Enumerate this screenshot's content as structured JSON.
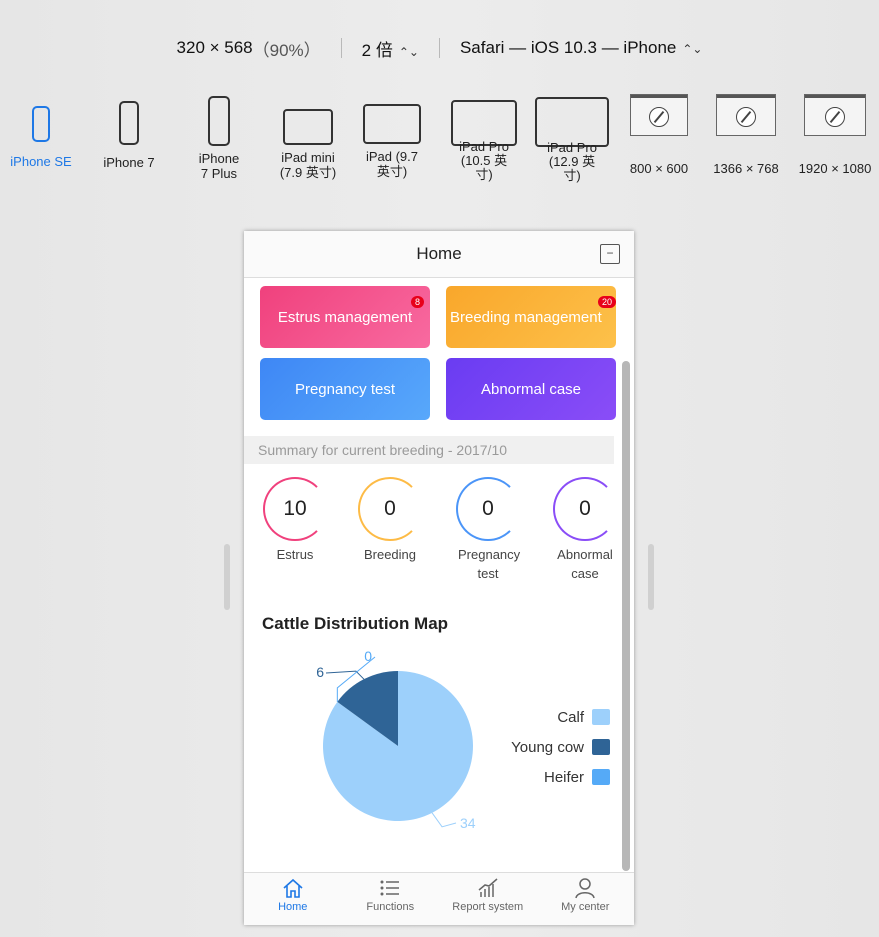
{
  "toolbar": {
    "resolution": "320 × 568",
    "zoom": "（90%）",
    "scale": "2 倍",
    "browser": "Safari — iOS 10.3 — iPhone"
  },
  "devices": [
    {
      "label": "iPhone SE",
      "icon": "phone-icon",
      "selected": true
    },
    {
      "label": "iPhone 7",
      "icon": "phone-icon",
      "selected": false
    },
    {
      "label": "iPhone 7 Plus",
      "icon": "phone-icon",
      "selected": false
    },
    {
      "label": "iPad mini (7.9 英寸)",
      "icon": "tablet-icon",
      "selected": false
    },
    {
      "label": "iPad (9.7 英寸)",
      "icon": "tablet-icon",
      "selected": false
    },
    {
      "label": "iPad Pro (10.5 英寸)",
      "icon": "tablet-icon",
      "selected": false
    },
    {
      "label": "iPad Pro (12.9 英寸)",
      "icon": "tablet-icon",
      "selected": false
    },
    {
      "label": "800 × 600",
      "icon": "safari-window-icon",
      "selected": false
    },
    {
      "label": "1366 × 768",
      "icon": "safari-window-icon",
      "selected": false
    },
    {
      "label": "1920 × 1080",
      "icon": "safari-window-icon",
      "selected": false
    }
  ],
  "app": {
    "title": "Home",
    "cards": [
      {
        "label": "Estrus management",
        "badge": "8",
        "color_from": "#f0417d",
        "color_to": "#f86aa0"
      },
      {
        "label": "Breeding management",
        "badge": "20",
        "color_from": "#f9a72b",
        "color_to": "#fdc14a"
      },
      {
        "label": "Pregnancy test",
        "badge": "",
        "color_from": "#3e87f5",
        "color_to": "#58a8fb"
      },
      {
        "label": "Abnormal case",
        "badge": "",
        "color_from": "#6a3cf2",
        "color_to": "#8a4df7"
      }
    ],
    "summary_title": "Summary for current breeding - 2017/10",
    "stats": [
      {
        "value": "10",
        "label": "Estrus",
        "color": "#f0417d"
      },
      {
        "value": "0",
        "label": "Breeding",
        "color": "#fdbb46"
      },
      {
        "value": "0",
        "label": "Pregnancy test",
        "color": "#4b95f8"
      },
      {
        "value": "0",
        "label": "Abnormal case",
        "color": "#8a4df7"
      }
    ],
    "map_title": "Cattle Distribution Map",
    "tabs": [
      {
        "label": "Home",
        "icon": "home-icon",
        "active": true
      },
      {
        "label": "Functions",
        "icon": "list-icon",
        "active": false
      },
      {
        "label": "Report system",
        "icon": "chart-icon",
        "active": false
      },
      {
        "label": "My center",
        "icon": "user-icon",
        "active": false
      }
    ]
  },
  "chart_data": {
    "type": "pie",
    "title": "Cattle Distribution Map",
    "slices": [
      {
        "name": "Calf",
        "value": 34,
        "color": "#9dd0fb"
      },
      {
        "name": "Young cow",
        "value": 6,
        "color": "#2f6496"
      },
      {
        "name": "Heifer",
        "value": 0,
        "color": "#55aaf7"
      }
    ],
    "legend_position": "right"
  }
}
